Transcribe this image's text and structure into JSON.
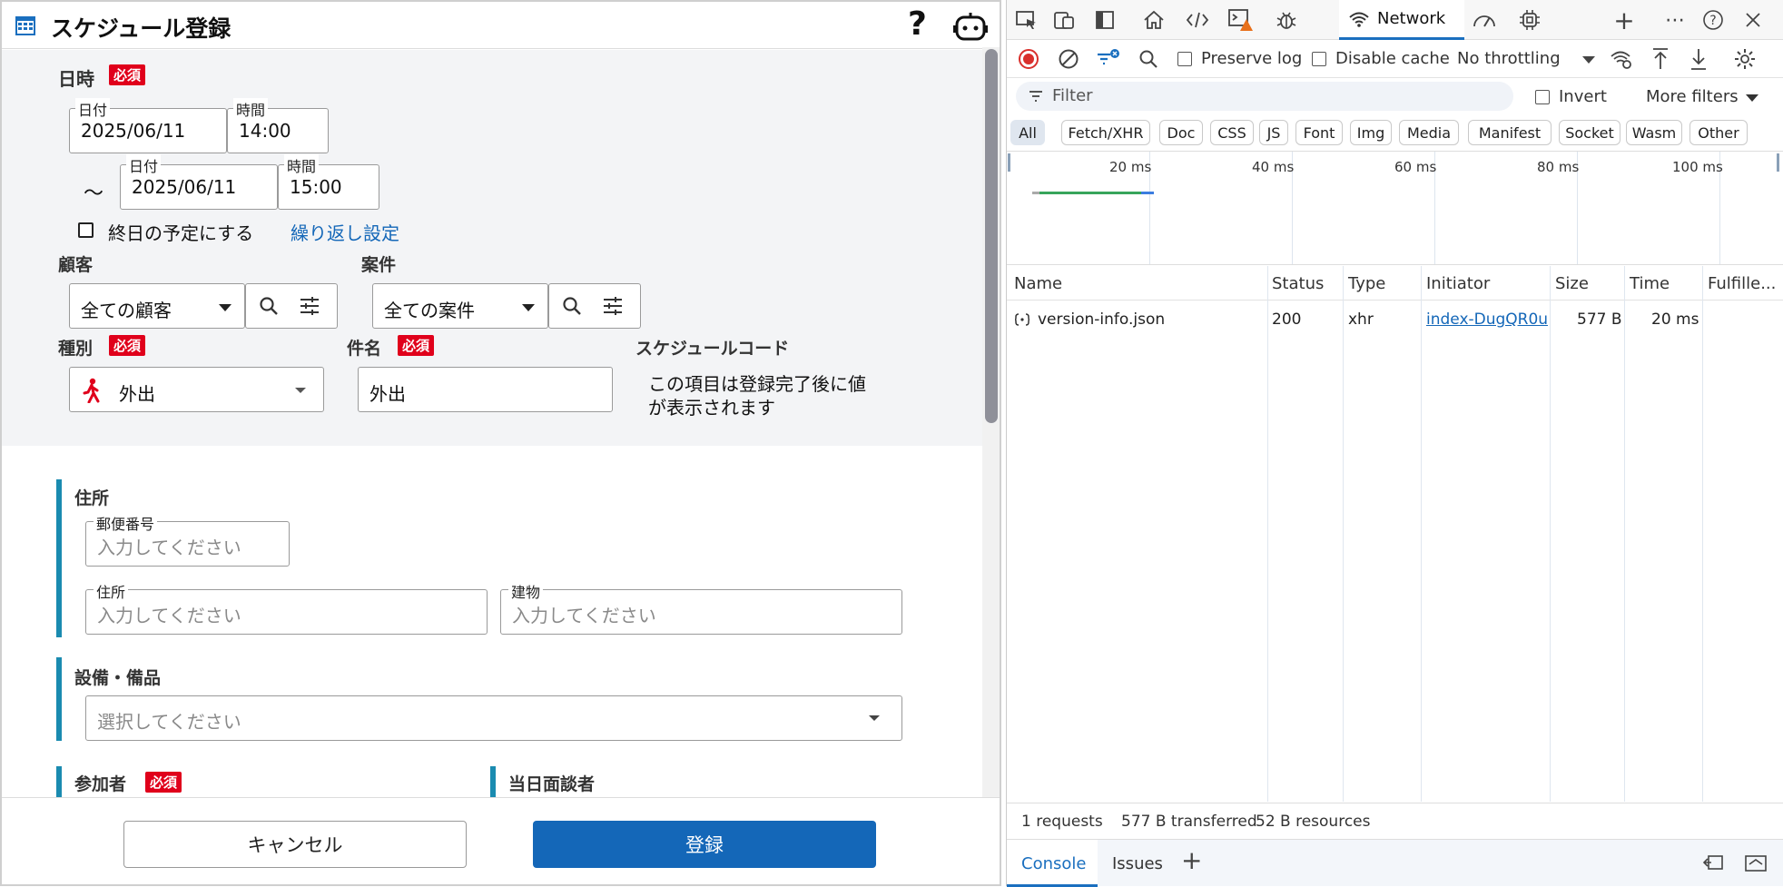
{
  "form": {
    "title": "スケジュール登録",
    "help": "?",
    "datetime": {
      "label": "日時",
      "required": "必須",
      "start_date_label": "日付",
      "start_date": "2025/06/11",
      "start_time_label": "時間",
      "start_time": "14:00",
      "tilde": "～",
      "end_date_label": "日付",
      "end_date": "2025/06/11",
      "end_time_label": "時間",
      "end_time": "15:00",
      "allday_label": "終日の予定にする",
      "repeat_link": "繰り返し設定"
    },
    "customer": {
      "label": "顧客",
      "value": "全ての顧客"
    },
    "project": {
      "label": "案件",
      "value": "全ての案件"
    },
    "kind": {
      "label": "種別",
      "required": "必須",
      "value": "外出"
    },
    "subject": {
      "label": "件名",
      "required": "必須",
      "value": "外出"
    },
    "code": {
      "label": "スケジュールコード",
      "note_line1": "この項目は登録完了後に値",
      "note_line2": "が表示されます"
    },
    "address": {
      "label": "住所",
      "postal_label": "郵便番号",
      "postal_placeholder": "入力してください",
      "address_label": "住所",
      "address_placeholder": "入力してください",
      "building_label": "建物",
      "building_placeholder": "入力してください"
    },
    "equipment": {
      "label": "設備・備品",
      "placeholder": "選択してください"
    },
    "participants": {
      "label": "参加者",
      "required": "必須"
    },
    "interviewer": {
      "label": "当日面談者"
    },
    "cancel": "キャンセル",
    "submit": "登録"
  },
  "devtools": {
    "active_tab": "Network",
    "preserve_log": "Preserve log",
    "disable_cache": "Disable cache",
    "throttling": "No throttling",
    "filter_placeholder": "Filter",
    "invert": "Invert",
    "more_filters": "More filters",
    "types": [
      "All",
      "Fetch/XHR",
      "Doc",
      "CSS",
      "JS",
      "Font",
      "Img",
      "Media",
      "Manifest",
      "Socket",
      "Wasm",
      "Other"
    ],
    "timeline_ticks": [
      "20 ms",
      "40 ms",
      "60 ms",
      "80 ms",
      "100 ms"
    ],
    "columns": [
      "Name",
      "Status",
      "Type",
      "Initiator",
      "Size",
      "Time",
      "Fulfille..."
    ],
    "rows": [
      {
        "name": "version-info.json",
        "status": "200",
        "type": "xhr",
        "initiator": "index-DugQR0u",
        "size": "577 B",
        "time": "20 ms"
      }
    ],
    "summary": {
      "requests": "1 requests",
      "transferred": "577 B transferred",
      "resources": "52 B resources"
    },
    "drawer_tabs": [
      "Console",
      "Issues"
    ],
    "plus": "+"
  },
  "colors": {
    "required": "#e0001b",
    "primary": "#1467b8",
    "section_bar": "#1a8bb0",
    "devtools_accent": "#1a6fbf"
  }
}
